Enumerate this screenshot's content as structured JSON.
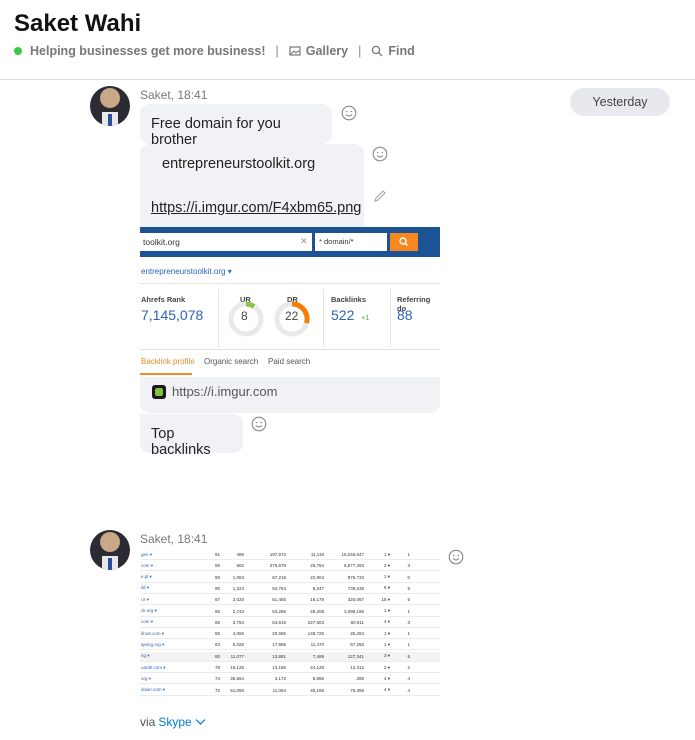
{
  "header": {
    "title": "Saket Wahi",
    "status": "Helping businesses get more business!",
    "separator": "|",
    "gallery_label": "Gallery",
    "find_label": "Find"
  },
  "date_divider": "Yesterday",
  "messages": [
    {
      "sender_meta": "Saket, 18:41",
      "bubbles": [
        "Free domain for you brother",
        "entrepreneurstoolkit.org",
        "https://i.imgur.com/F4xbm65.png",
        "Top backlinks"
      ],
      "preview": {
        "search_value": "toolkit.org",
        "mode": "* domain/*",
        "domain": "entrepreneurstoolkit.org ▾",
        "metrics": [
          {
            "label": "Ahrefs Rank",
            "value": "7,145,078"
          },
          {
            "label": "UR",
            "value": "8"
          },
          {
            "label": "DR",
            "value": "22"
          },
          {
            "label": "Backlinks",
            "value": "522"
          },
          {
            "label": "Referring do",
            "value": "88"
          }
        ],
        "backlinks_delta": "+1",
        "tabs": [
          "Backlink profile",
          "Organic search",
          "Paid search"
        ],
        "link_host": "https://i.imgur.com"
      }
    },
    {
      "sender_meta": "Saket, 18:41",
      "via_prefix": "via",
      "via_link": "Skype",
      "table_rows": [
        [
          "gen ▾",
          "91",
          "489",
          "197,672",
          "11,118",
          "15,046,647",
          "1 ▾",
          "1"
        ],
        [
          "com ▾",
          "90",
          "662",
          "270,678",
          "26,764",
          "6,577,293",
          "2 ▾",
          "3"
        ],
        [
          "e.pl ▾",
          "90",
          "1,063",
          "67,215",
          "22,904",
          "976,733",
          "1 ▾",
          "0"
        ],
        [
          "ild ▾",
          "90",
          "1,224",
          "54,764",
          "8,247",
          "739,535",
          "5 ▾",
          "5"
        ],
        [
          "i.it ▾",
          "87",
          "2,020",
          "81,465",
          "16,179",
          "320,087",
          "15 ▾",
          "5"
        ],
        [
          "ck.org ▾",
          "86",
          "2,743",
          "63,286",
          "29,208",
          "3,098,196",
          "1 ▾",
          "1"
        ],
        [
          "com ▾",
          "85",
          "3,784",
          "64,619",
          "227,603",
          "90,911",
          "4 ▾",
          "3"
        ],
        [
          "ifrost.com ▾",
          "85",
          "4,066",
          "20,686",
          "148,725",
          "26,284",
          "1 ▾",
          "1"
        ],
        [
          "igning.org ▾",
          "83",
          "5,026",
          "17,686",
          "11,470",
          "67,250",
          "1 ▾",
          "1"
        ],
        [
          "ng ▾",
          "80",
          "11,077",
          "13,881",
          "7,469",
          "127,341",
          "3 ▾",
          "5"
        ],
        [
          "oardit.com ▾",
          "78",
          "16,125",
          "13,186",
          "24,128",
          "12,312",
          "2 ▾",
          "2"
        ],
        [
          "org ▾",
          "74",
          "35,664",
          "3,172",
          "5,856",
          "288",
          "4 ▾",
          "4"
        ],
        [
          "down.com ▾",
          "72",
          "51,050",
          "11,064",
          "40,168",
          "75,459",
          "4 ▾",
          "4"
        ]
      ]
    }
  ]
}
